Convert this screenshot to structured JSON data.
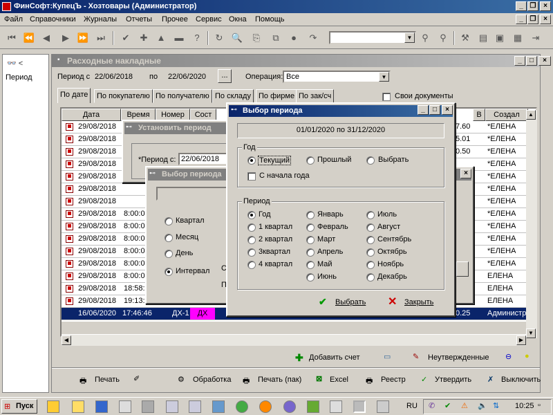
{
  "window": {
    "title": "ФинСофт:КупецЪ - Хозтовары  (Администратор)"
  },
  "menu": [
    "Файл",
    "Справочники",
    "Журналы",
    "Отчеты",
    "Прочее",
    "Сервис",
    "Окна",
    "Помощь"
  ],
  "toolbar": {
    "search_value": ""
  },
  "left_panel": {
    "item_label": "Период"
  },
  "doc_window": {
    "title": "Расходные накладные",
    "period_from_label": "Период с",
    "period_from": "22/06/2018",
    "period_to_label": "по",
    "period_to": "22/06/2020",
    "ellipsis": "...",
    "operation_label": "Операция:",
    "operation_value": "Все",
    "own_docs_label": "Свои документы",
    "tabs": [
      "По дате",
      "По покупателю",
      "По получателю",
      "По складу",
      "По фирме",
      "По зак/сч"
    ],
    "columns": {
      "date": "Дата",
      "time": "Время",
      "number": "Номер",
      "state": "Сост",
      "v": "В",
      "creator": "Создал"
    },
    "rows": [
      {
        "date": "29/08/2018",
        "time": "",
        "amount": "7.60",
        "creator": "*ЕЛЕНА"
      },
      {
        "date": "29/08/2018",
        "time": "",
        "amount": "5.01",
        "creator": "*ЕЛЕНА"
      },
      {
        "date": "29/08/2018",
        "time": "",
        "amount": "0.50",
        "creator": "*ЕЛЕНА"
      },
      {
        "date": "29/08/2018",
        "time": "",
        "amount": "",
        "creator": "*ЕЛЕНА"
      },
      {
        "date": "29/08/2018",
        "time": "",
        "amount": "",
        "creator": "*ЕЛЕНА"
      },
      {
        "date": "29/08/2018",
        "time": "",
        "amount": "",
        "creator": "*ЕЛЕНА"
      },
      {
        "date": "29/08/2018",
        "time": "",
        "amount": "",
        "creator": "*ЕЛЕНА"
      },
      {
        "date": "29/08/2018",
        "time": "8:00:0",
        "amount": "",
        "creator": "*ЕЛЕНА"
      },
      {
        "date": "29/08/2018",
        "time": "8:00:0",
        "amount": "",
        "creator": "*ЕЛЕНА"
      },
      {
        "date": "29/08/2018",
        "time": "8:00:0",
        "amount": "",
        "creator": "*ЕЛЕНА"
      },
      {
        "date": "29/08/2018",
        "time": "8:00:0",
        "amount": "",
        "creator": "*ЕЛЕНА"
      },
      {
        "date": "29/08/2018",
        "time": "8:00:0",
        "amount": "",
        "creator": "*ЕЛЕНА"
      },
      {
        "date": "29/08/2018",
        "time": "8:00:0",
        "amount": "",
        "creator": "ЕЛЕНА"
      },
      {
        "date": "29/08/2018",
        "time": "18:58:",
        "amount": "",
        "creator": "ЕЛЕНА"
      },
      {
        "date": "29/08/2018",
        "time": "19:13:",
        "amount": "",
        "creator": "ЕЛЕНА"
      }
    ],
    "selected_row": {
      "date": "16/06/2020",
      "time": "17:46:46",
      "number": "ДХ-1",
      "state": "ДХ",
      "amount": "0.25",
      "creator": "Администр"
    },
    "bottom_actions": {
      "add_invoice": "Добавить счет",
      "unconfirmed": "Неутвержденные"
    }
  },
  "footer_buttons": [
    "Печать",
    "Обработка",
    "Печать (пак)",
    "Excel",
    "Реестр",
    "Утвердить",
    "Выключить"
  ],
  "dlg_set_period": {
    "title": "Установить период",
    "period_label": "*Период с:",
    "period_value": "22/06/2018"
  },
  "dlg_choose_back": {
    "title": "Выбор периода",
    "options": [
      "Квартал",
      "Месяц",
      "День",
      "Интервал"
    ],
    "partial_c": "С",
    "partial_p": "П"
  },
  "dlg_choose": {
    "title": "Выбор периода",
    "range": "01/01/2020 по 31/12/2020",
    "year_group": "Год",
    "year_options": [
      "Текущий",
      "Прошлый",
      "Выбрать"
    ],
    "from_start_label": "С начала года",
    "period_group": "Период",
    "period_col1": [
      "Год",
      "1 квартал",
      "2 квартал",
      "3квартал",
      "4 квартал"
    ],
    "period_col2": [
      "Январь",
      "Февраль",
      "Март",
      "Апрель",
      "Май",
      "Июнь"
    ],
    "period_col3": [
      "Июль",
      "Август",
      "Сентябрь",
      "Октябрь",
      "Ноябрь",
      "Декабрь"
    ],
    "select_btn": "Выбрать",
    "close_btn": "Закрыть"
  },
  "taskbar": {
    "start": "Пуск",
    "lang": "RU",
    "clock": "10:25"
  }
}
